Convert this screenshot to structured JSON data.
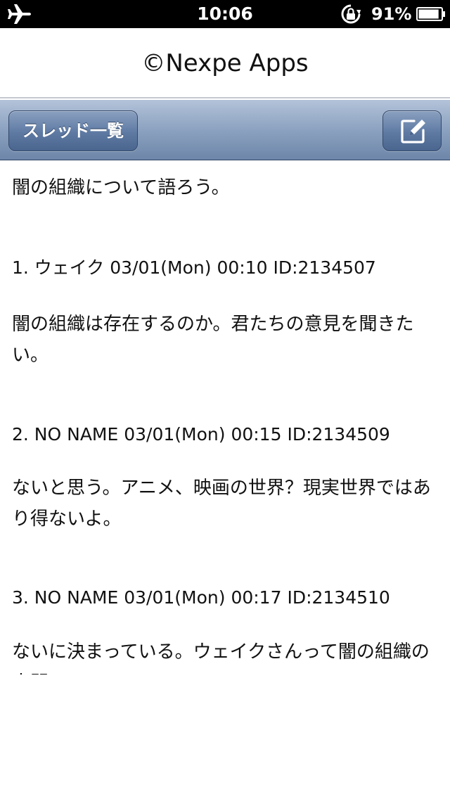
{
  "status_bar": {
    "time": "10:06",
    "battery_percent": "91%",
    "battery_level": 0.91,
    "icons": [
      "airplane-icon",
      "rotation-lock-icon",
      "battery-icon"
    ]
  },
  "header": {
    "title": "©Nexpe Apps"
  },
  "toolbar": {
    "back_label": "スレッド一覧",
    "compose_icon": "compose-icon"
  },
  "thread": {
    "title": "闇の組織について語ろう。",
    "posts": [
      {
        "header": "1. ウェイク 03/01(Mon) 00:10 ID:2134507",
        "body": "闇の組織は存在するのか。君たちの意見を聞きたい。"
      },
      {
        "header": "2. NO NAME 03/01(Mon) 00:15 ID:2134509",
        "body": "ないと思う。アニメ、映画の世界？現実世界ではあり得ないよ。"
      },
      {
        "header": "3. NO NAME 03/01(Mon) 00:17 ID:2134510",
        "body": "ないに決まっている。ウェイクさんって闇の組織の人間？"
      }
    ]
  },
  "colors": {
    "status_bar_bg": "#000000",
    "toolbar_top": "#b3c3d9",
    "toolbar_bottom": "#6d86a9",
    "button_bg": "#5e7aa3",
    "text": "#111111"
  }
}
